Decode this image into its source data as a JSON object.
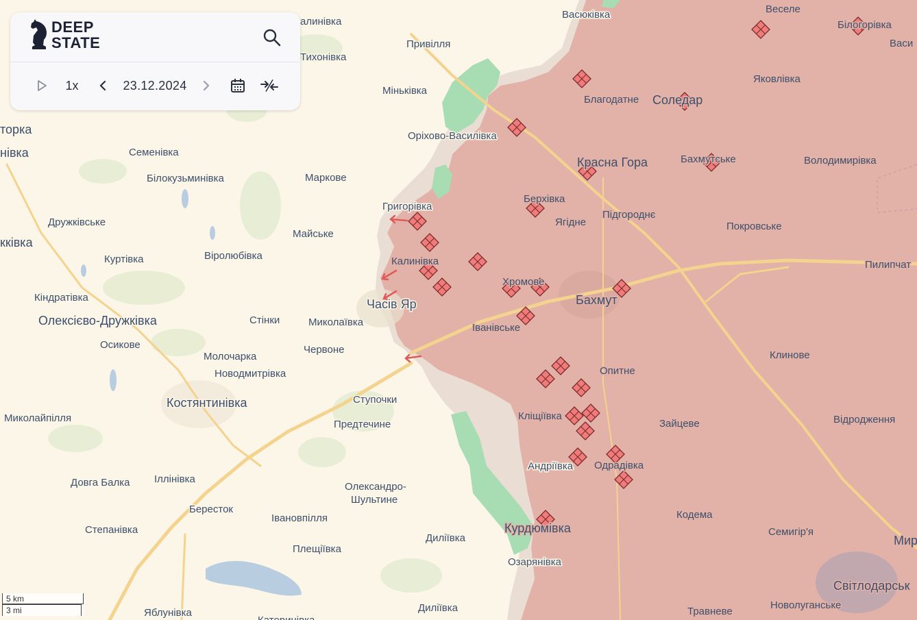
{
  "app": {
    "logo_line1": "DEEP",
    "logo_line2": "STATE",
    "speed": "1x",
    "date": "23.12.2024"
  },
  "icons": [
    "search-icon",
    "play-icon",
    "chevron-left-icon",
    "chevron-right-icon",
    "calendar-icon",
    "collapse-arrows-icon",
    "knight-logo-icon"
  ],
  "colors": {
    "occupied": "#e2b2a8",
    "contested": "#e9ddd4",
    "liberated": "#a8dcb3",
    "road": "#f3d38e",
    "land": "#fbf6e8",
    "water": "#b9cde0",
    "marker": "#ef7b7b"
  },
  "scale": {
    "km": "5 km",
    "mi": "3 mi"
  },
  "places": {
    "p01": "Васюківка",
    "p02": "Веселе",
    "p03": "Білогорівка",
    "p04": "Васи",
    "p05": "алинівка",
    "p06": "Тихонівка",
    "p07": "Привілля",
    "p08": "Яковлівка",
    "p09": "Міньківка",
    "p10": "Благодатне",
    "p11": "Соледар",
    "p12": "торка",
    "p13": "нівка",
    "p14": "Оріхово-Василівка",
    "p15": "Семенівка",
    "p16": "Красна Гора",
    "p17": "Бахмутське",
    "p18": "Володимирівка",
    "p19": "Білокузьминівка",
    "p20": "Маркове",
    "p21": "Григорівка",
    "p22": "Берхівка",
    "p23": "Ягідне",
    "p24": "Підгороднє",
    "p25": "Покровське",
    "p26": "Дружківське",
    "p27": "Майське",
    "p28": "кківка",
    "p29": "Куртівка",
    "p30": "Віролюбівка",
    "p31": "Калинівка",
    "p32": "Пилипчат",
    "p33": "Кіндратівка",
    "p34": "Хромове",
    "p35": "Часів Яр",
    "p36": "Бахмут",
    "p37": "Олексієво-Дружківка",
    "p38": "Стінки",
    "p39": "Миколаївка",
    "p40": "Іванівське",
    "p41": "Осикове",
    "p42": "Червоне",
    "p43": "Молочарка",
    "p44": "Клинове",
    "p45": "Новодмитрівка",
    "p46": "Опитне",
    "p47": "Ступочки",
    "p48": "Костянтинівка",
    "p49": "Миколайпілля",
    "p50": "Кліщіївка",
    "p51": "Відродження",
    "p52": "Предтечине",
    "p53": "Зайцеве",
    "p54": "Андріївка",
    "p55": "Одрадівка",
    "p56": "Довга Балка",
    "p57": "Іллінівка",
    "p58": "Олександро-",
    "p59": "Шультине",
    "p60": "Бересток",
    "p61": "Кодема",
    "p62": "Івановпілля",
    "p63": "Степанівка",
    "p64": "Курдюмівка",
    "p65": "Семигір'я",
    "p66": "Мир",
    "p67": "Дилiївка",
    "p68": "Плещіївка",
    "p69": "Озарянівка",
    "p70": "Світлодарськ",
    "p71": "Дилiївка",
    "p72": "Яблунівка",
    "p73": "Травневе",
    "p74": "Новолуганське",
    "p75": "Катеринівка"
  }
}
